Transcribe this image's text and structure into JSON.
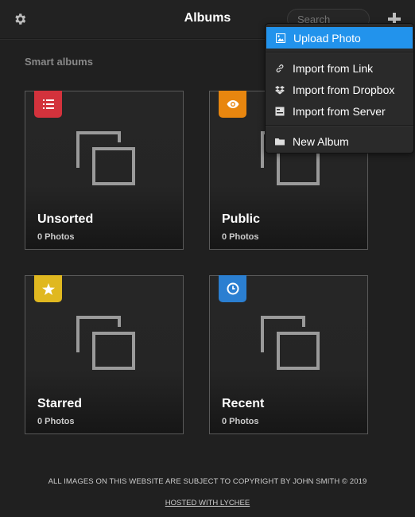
{
  "header": {
    "title": "Albums",
    "search_placeholder": "Search",
    "settings_icon": "gear-icon",
    "add_icon": "plus-icon"
  },
  "smart_albums": {
    "title": "Smart albums",
    "albums": [
      {
        "name": "Unsorted",
        "count": "0 Photos",
        "badge_icon": "list-icon",
        "badge_color": "#d3323c"
      },
      {
        "name": "Public",
        "count": "0 Photos",
        "badge_icon": "eye-icon",
        "badge_color": "#e8860f"
      },
      {
        "name": "Starred",
        "count": "0 Photos",
        "badge_icon": "star-icon",
        "badge_color": "#e0b820"
      },
      {
        "name": "Recent",
        "count": "0 Photos",
        "badge_icon": "clock-icon",
        "badge_color": "#2b7fd1"
      }
    ]
  },
  "add_menu": {
    "items": [
      {
        "label": "Upload Photo",
        "icon": "upload-photo-icon",
        "active": true
      },
      {
        "label": "Import from Link",
        "icon": "link-icon"
      },
      {
        "label": "Import from Dropbox",
        "icon": "dropbox-icon"
      },
      {
        "label": "Import from Server",
        "icon": "server-icon"
      },
      {
        "label": "New Album",
        "icon": "folder-icon"
      }
    ]
  },
  "footer": {
    "copyright": "ALL IMAGES ON THIS WEBSITE ARE SUBJECT TO COPYRIGHT BY JOHN SMITH © 2019",
    "hosted": "HOSTED WITH LYCHEE"
  },
  "colors": {
    "accent": "#2293ec",
    "background": "#202020"
  }
}
